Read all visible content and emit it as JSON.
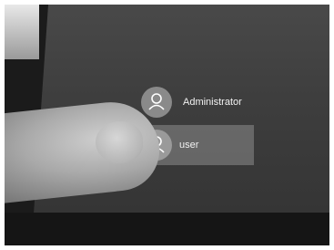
{
  "accounts": [
    {
      "label": "Administrator",
      "icon": "user-avatar-icon"
    },
    {
      "label": "user",
      "icon": "user-avatar-icon",
      "selected": true
    }
  ]
}
